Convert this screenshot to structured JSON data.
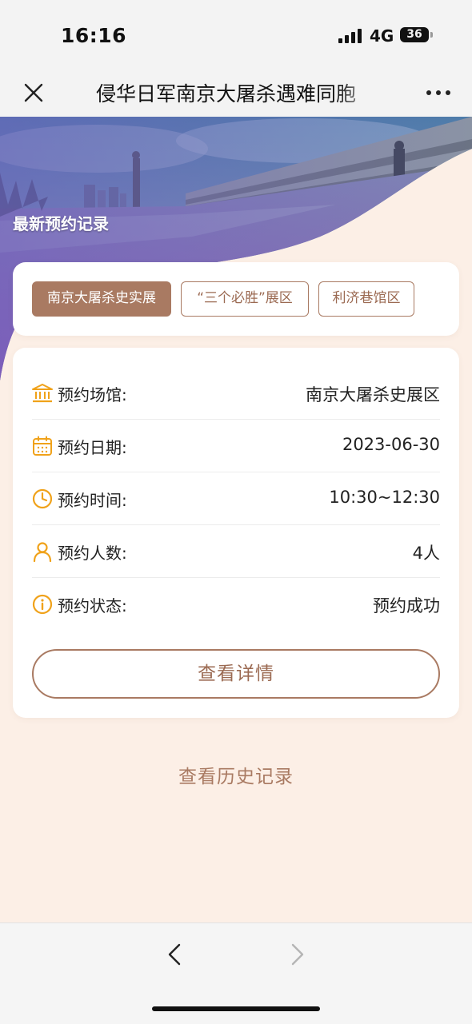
{
  "status_bar": {
    "time": "16:16",
    "network": "4G",
    "battery": "36"
  },
  "nav": {
    "title": "侵华日军南京大屠杀遇难同胞"
  },
  "banner": {
    "title": "最新预约记录"
  },
  "tabs": [
    {
      "label": "南京大屠杀史实展",
      "active": true
    },
    {
      "label": "“三个必胜”展区",
      "active": false
    },
    {
      "label": "利济巷馆区",
      "active": false
    }
  ],
  "reservation": {
    "venue_label": "预约场馆:",
    "venue_value": "南京大屠杀史展区",
    "date_label": "预约日期:",
    "date_value": "2023-06-30",
    "time_label": "预约时间:",
    "time_value": "10:30~12:30",
    "people_label": "预约人数:",
    "people_value": "4人",
    "status_label": "预约状态:",
    "status_value": "预约成功"
  },
  "buttons": {
    "detail": "查看详情",
    "history": "查看历史记录"
  },
  "colors": {
    "accent_brown": "#a97a62",
    "icon_orange": "#f0a21a",
    "content_bg": "#fcefe6"
  },
  "icons": {
    "venue": "museum-icon",
    "date": "calendar-icon",
    "time": "clock-icon",
    "people": "person-icon",
    "status": "info-icon"
  }
}
